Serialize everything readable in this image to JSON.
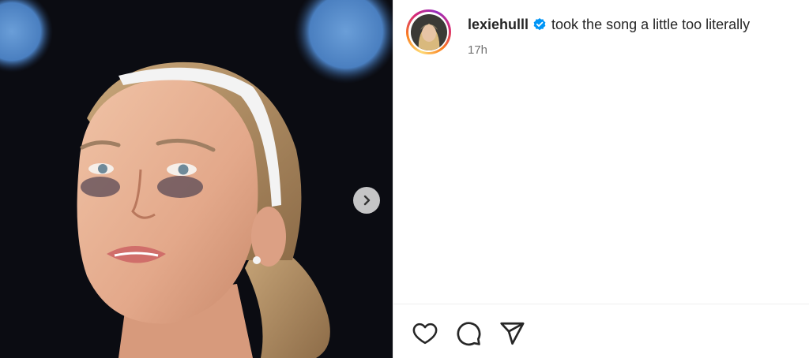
{
  "post": {
    "username": "lexiehulll",
    "caption": "took the song a little too literally",
    "timestamp": "17h",
    "verified": true,
    "verified_color": "#0095f6"
  },
  "media": {
    "carousel_next": "chevron-right-icon"
  },
  "actions": [
    "heart-icon",
    "comment-icon",
    "share-icon"
  ]
}
